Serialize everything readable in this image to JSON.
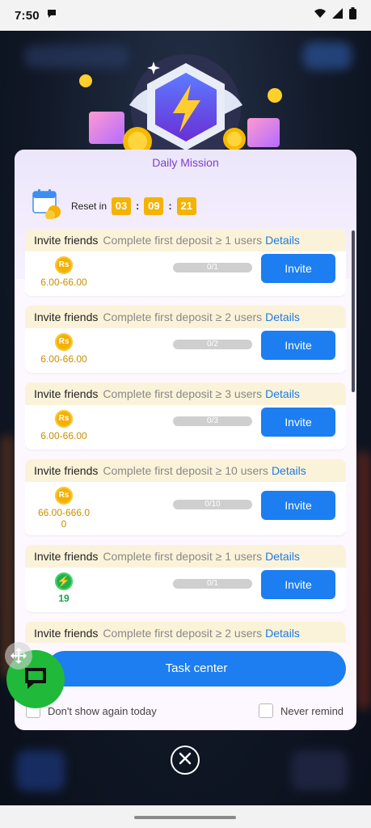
{
  "status": {
    "time": "7:50"
  },
  "dialog": {
    "title": "Daily Mission",
    "reset_label": "Reset in",
    "timer": {
      "h": "03",
      "m": "09",
      "s": "21"
    }
  },
  "missions": [
    {
      "type": "Invite friends",
      "desc": "Complete first deposit ≥ 1 users",
      "details": "Details",
      "reward_icon": "rupee-coin-icon",
      "reward": "6.00-66.00",
      "progress": "0/1",
      "button": "Invite"
    },
    {
      "type": "Invite friends",
      "desc": "Complete first deposit ≥ 2 users",
      "details": "Details",
      "reward_icon": "rupee-coin-icon",
      "reward": "6.00-66.00",
      "progress": "0/2",
      "button": "Invite"
    },
    {
      "type": "Invite friends",
      "desc": "Complete first deposit ≥ 3 users",
      "details": "Details",
      "reward_icon": "rupee-coin-icon",
      "reward": "6.00-66.00",
      "progress": "0/3",
      "button": "Invite"
    },
    {
      "type": "Invite friends",
      "desc": "Complete first deposit ≥ 10 users",
      "details": "Details",
      "reward_icon": "rupee-coin-icon",
      "reward_line1": "66.00-666.0",
      "reward_line2": "0",
      "progress": "0/10",
      "button": "Invite"
    },
    {
      "type": "Invite friends",
      "desc": "Complete first deposit ≥ 1 users",
      "details": "Details",
      "reward_icon": "energy-bolt-icon",
      "reward": "19",
      "progress": "0/1",
      "button": "Invite"
    },
    {
      "type": "Invite friends",
      "desc": "Complete first deposit ≥ 2 users",
      "details": "Details"
    }
  ],
  "coin_symbol": "Rs",
  "task_center_label": "Task center",
  "options": {
    "dont_show": "Don't show again today",
    "never_remind": "Never remind"
  },
  "colors": {
    "primary": "#1c7ef0",
    "gold": "#f5b200",
    "title": "#7c3fd0",
    "fab": "#20b93a"
  }
}
